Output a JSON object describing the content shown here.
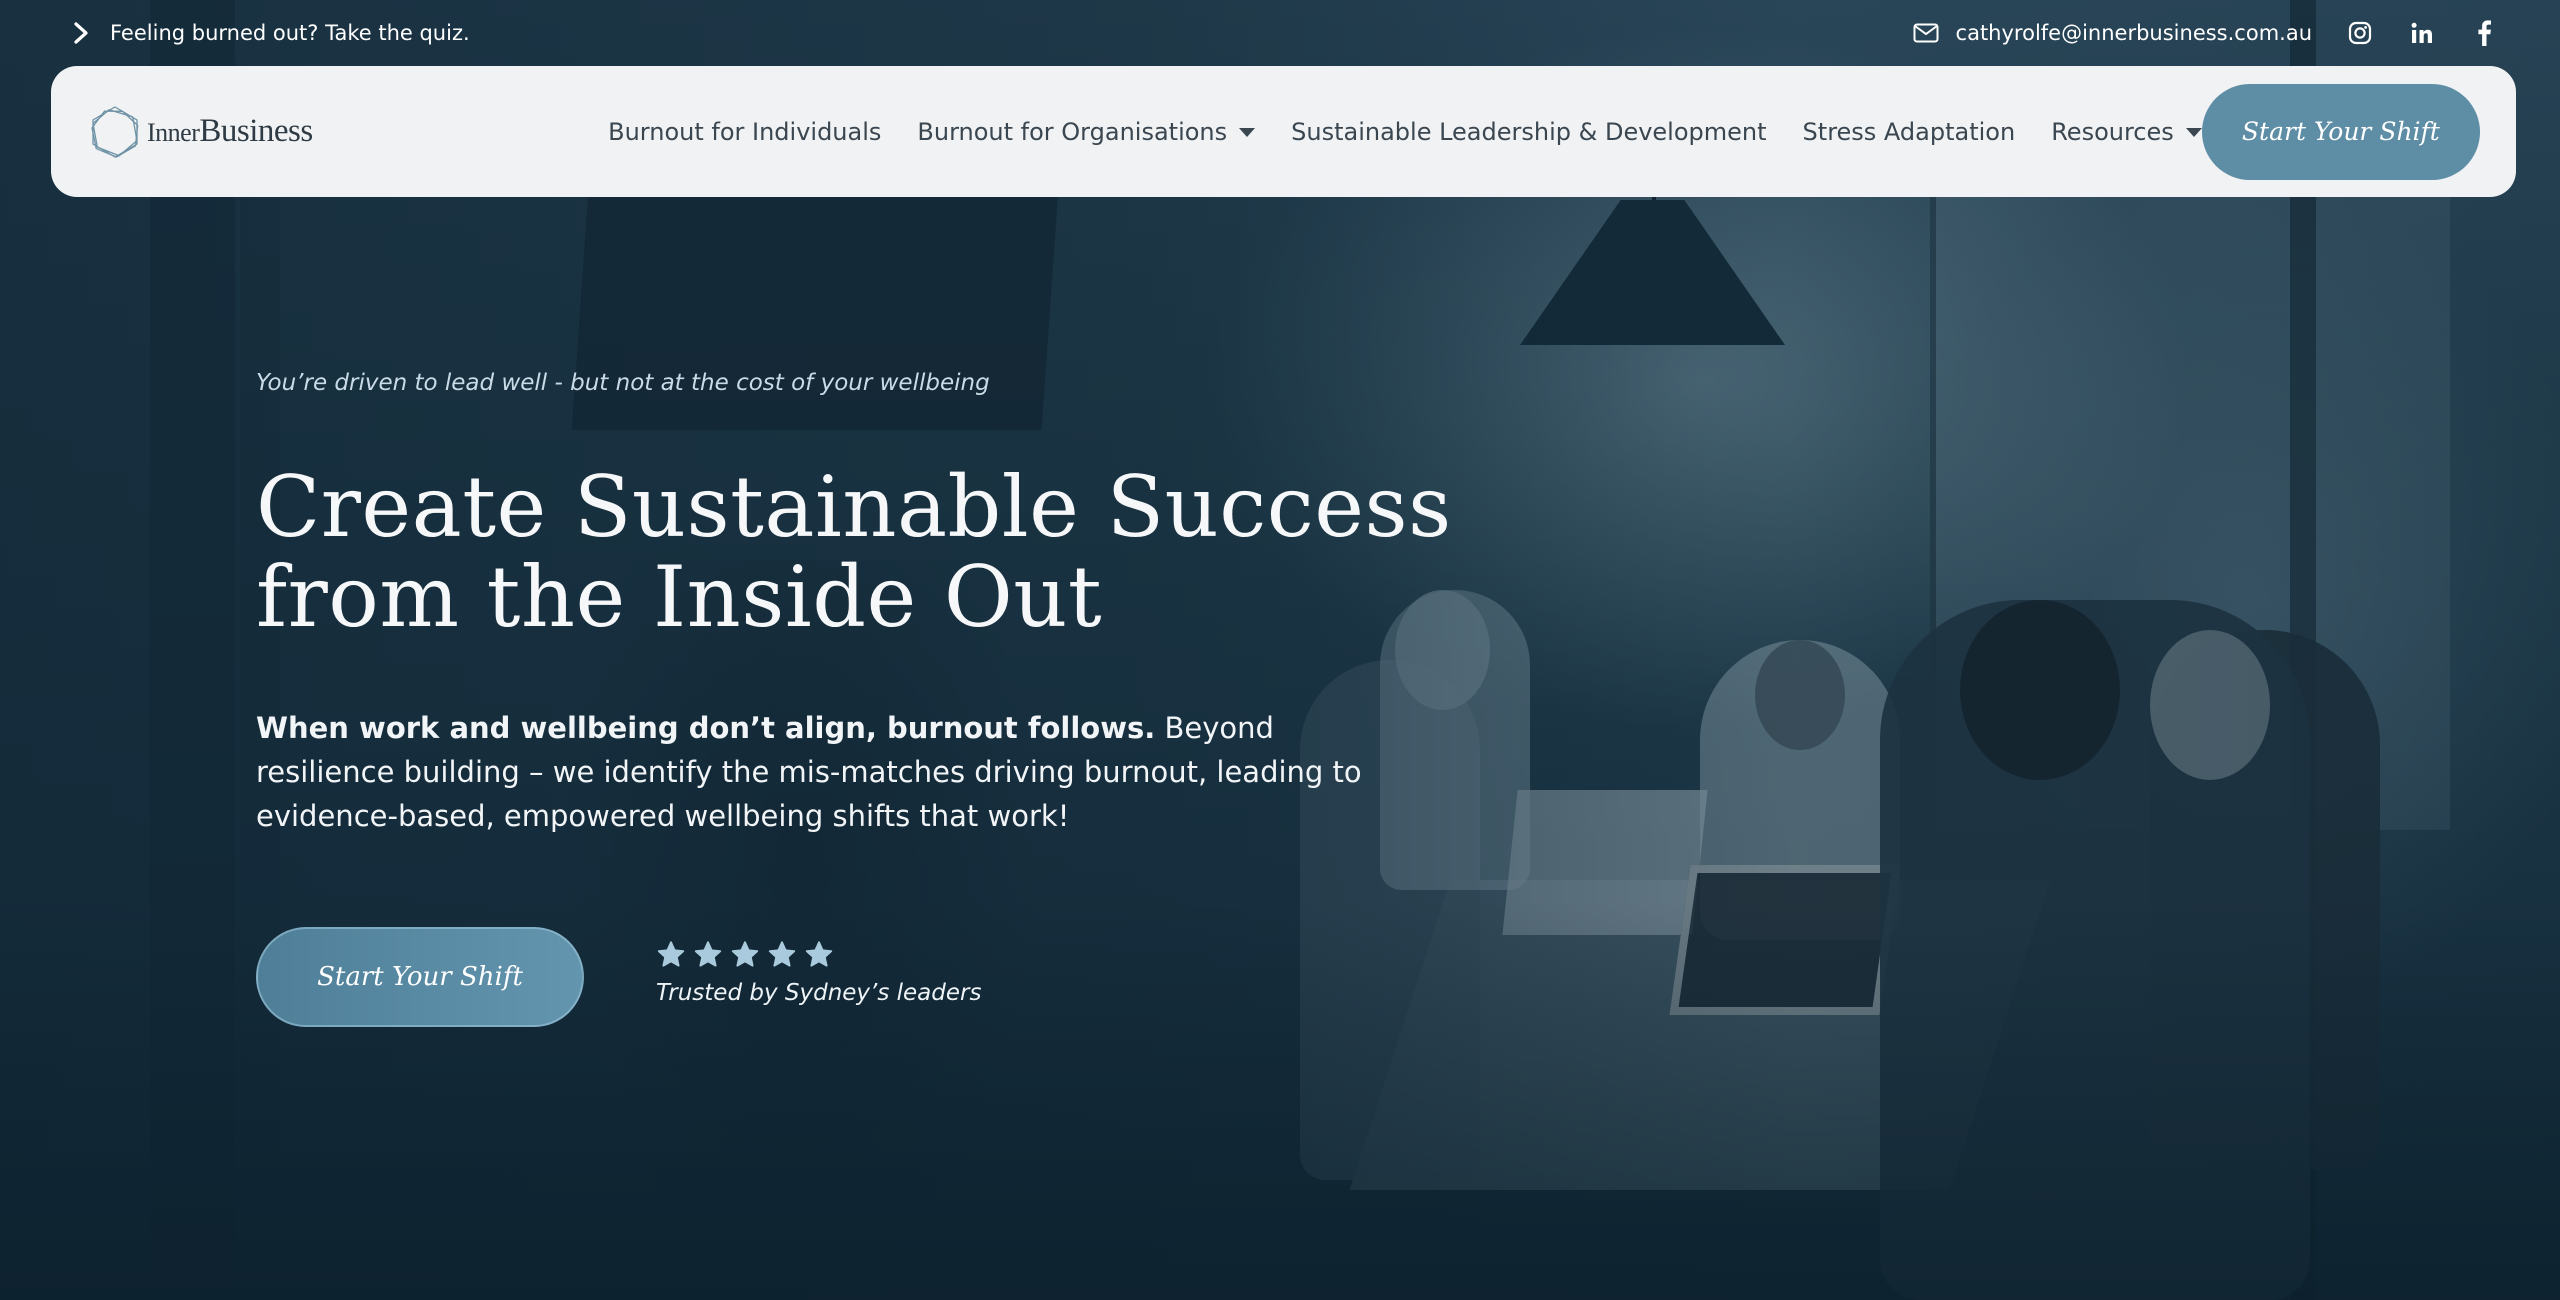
{
  "topbar": {
    "quiz_link": "Feeling burned out? Take the quiz.",
    "email": "cathyrolfe@innerbusiness.com.au",
    "social": [
      "instagram-icon",
      "linkedin-icon",
      "facebook-icon"
    ]
  },
  "brand": {
    "inner": "Inner",
    "business": "Business"
  },
  "nav": {
    "items": [
      {
        "label": "Burnout for Individuals",
        "dropdown": false
      },
      {
        "label": "Burnout for Organisations",
        "dropdown": true
      },
      {
        "label": "Sustainable Leadership & Development",
        "dropdown": false
      },
      {
        "label": "Stress Adaptation",
        "dropdown": false
      },
      {
        "label": "Resources",
        "dropdown": true
      }
    ],
    "cta": "Start Your Shift"
  },
  "hero": {
    "eyebrow": "You’re driven to lead well - but not at the cost of your wellbeing",
    "headline_line1": "Create Sustainable Success",
    "headline_line2": "from the Inside Out",
    "lead_bold": "When work and wellbeing don’t align, burnout follows.",
    "lead_rest": " Beyond resilience building – we identify the mis-matches driving burnout, leading to evidence-based, empowered wellbeing shifts that work!",
    "cta": "Start Your Shift",
    "rating_stars": 5,
    "trust_text": "Trusted by Sydney’s leaders"
  },
  "colors": {
    "accent": "#5e8da6",
    "nav_bg": "#f1f2f3",
    "star": "#a9c9dc",
    "hero_overlay": "#1b3a4d"
  }
}
